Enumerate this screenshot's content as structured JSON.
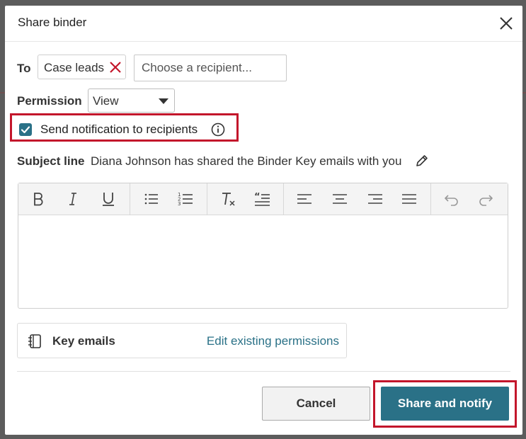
{
  "dialog": {
    "title": "Share binder",
    "close_icon": "close-icon"
  },
  "recipients": {
    "to_label": "To",
    "chips": [
      {
        "label": "Case leads",
        "remove_icon": "remove-x-icon",
        "remove_color": "#c3162b"
      }
    ],
    "input_placeholder": "Choose a recipient..."
  },
  "permission": {
    "label": "Permission",
    "selected": "View"
  },
  "notification": {
    "checked": true,
    "label": "Send notification to recipients",
    "info_icon": "info-icon"
  },
  "subject": {
    "label": "Subject line",
    "value": "Diana Johnson has shared the Binder Key emails with you",
    "edit_icon": "pencil-icon"
  },
  "editor": {
    "toolbar": [
      "bold",
      "italic",
      "underline",
      "bulleted-list",
      "numbered-list",
      "clear-formatting",
      "blockquote",
      "align-left",
      "align-center",
      "align-right",
      "justify",
      "undo",
      "redo"
    ],
    "body": ""
  },
  "binder": {
    "icon": "binder-icon",
    "name": "Key emails",
    "edit_link": "Edit existing permissions"
  },
  "actions": {
    "cancel": "Cancel",
    "share": "Share and notify"
  },
  "colors": {
    "accent": "#2a7187",
    "highlight": "#c3162b"
  }
}
